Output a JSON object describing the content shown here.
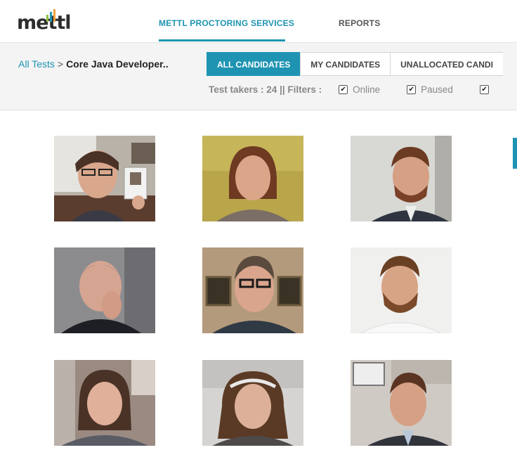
{
  "nav": {
    "logo": "mettl",
    "links": [
      {
        "label": "METTL PROCTORING SERVICES",
        "active": true
      },
      {
        "label": "REPORTS",
        "active": false
      }
    ]
  },
  "breadcrumb": {
    "root": "All Tests",
    "separator": ">",
    "current": "Core Java Developer.."
  },
  "tabs": [
    {
      "label": "ALL CANDIDATES",
      "active": true
    },
    {
      "label": "MY CANDIDATES",
      "active": false
    },
    {
      "label": "UNALLOCATED CANDI",
      "active": false
    }
  ],
  "filters": {
    "summary": "Test takers : 24 || Filters :",
    "options": [
      {
        "label": "Online",
        "checked": true
      },
      {
        "label": "Paused",
        "checked": true
      },
      {
        "label": "",
        "checked": true
      }
    ]
  },
  "candidates": [
    {
      "icon": "webcam-feed-icon"
    },
    {
      "icon": "webcam-feed-icon"
    },
    {
      "icon": "webcam-feed-icon"
    },
    {
      "icon": "webcam-feed-icon"
    },
    {
      "icon": "webcam-feed-icon"
    },
    {
      "icon": "webcam-feed-icon"
    },
    {
      "icon": "webcam-feed-icon"
    },
    {
      "icon": "webcam-feed-icon"
    },
    {
      "icon": "webcam-feed-icon"
    }
  ],
  "colors": {
    "accent": "#1e94b2",
    "logo_bars": [
      "#8dbf3f",
      "#1e94b2",
      "#f0a23b"
    ]
  }
}
